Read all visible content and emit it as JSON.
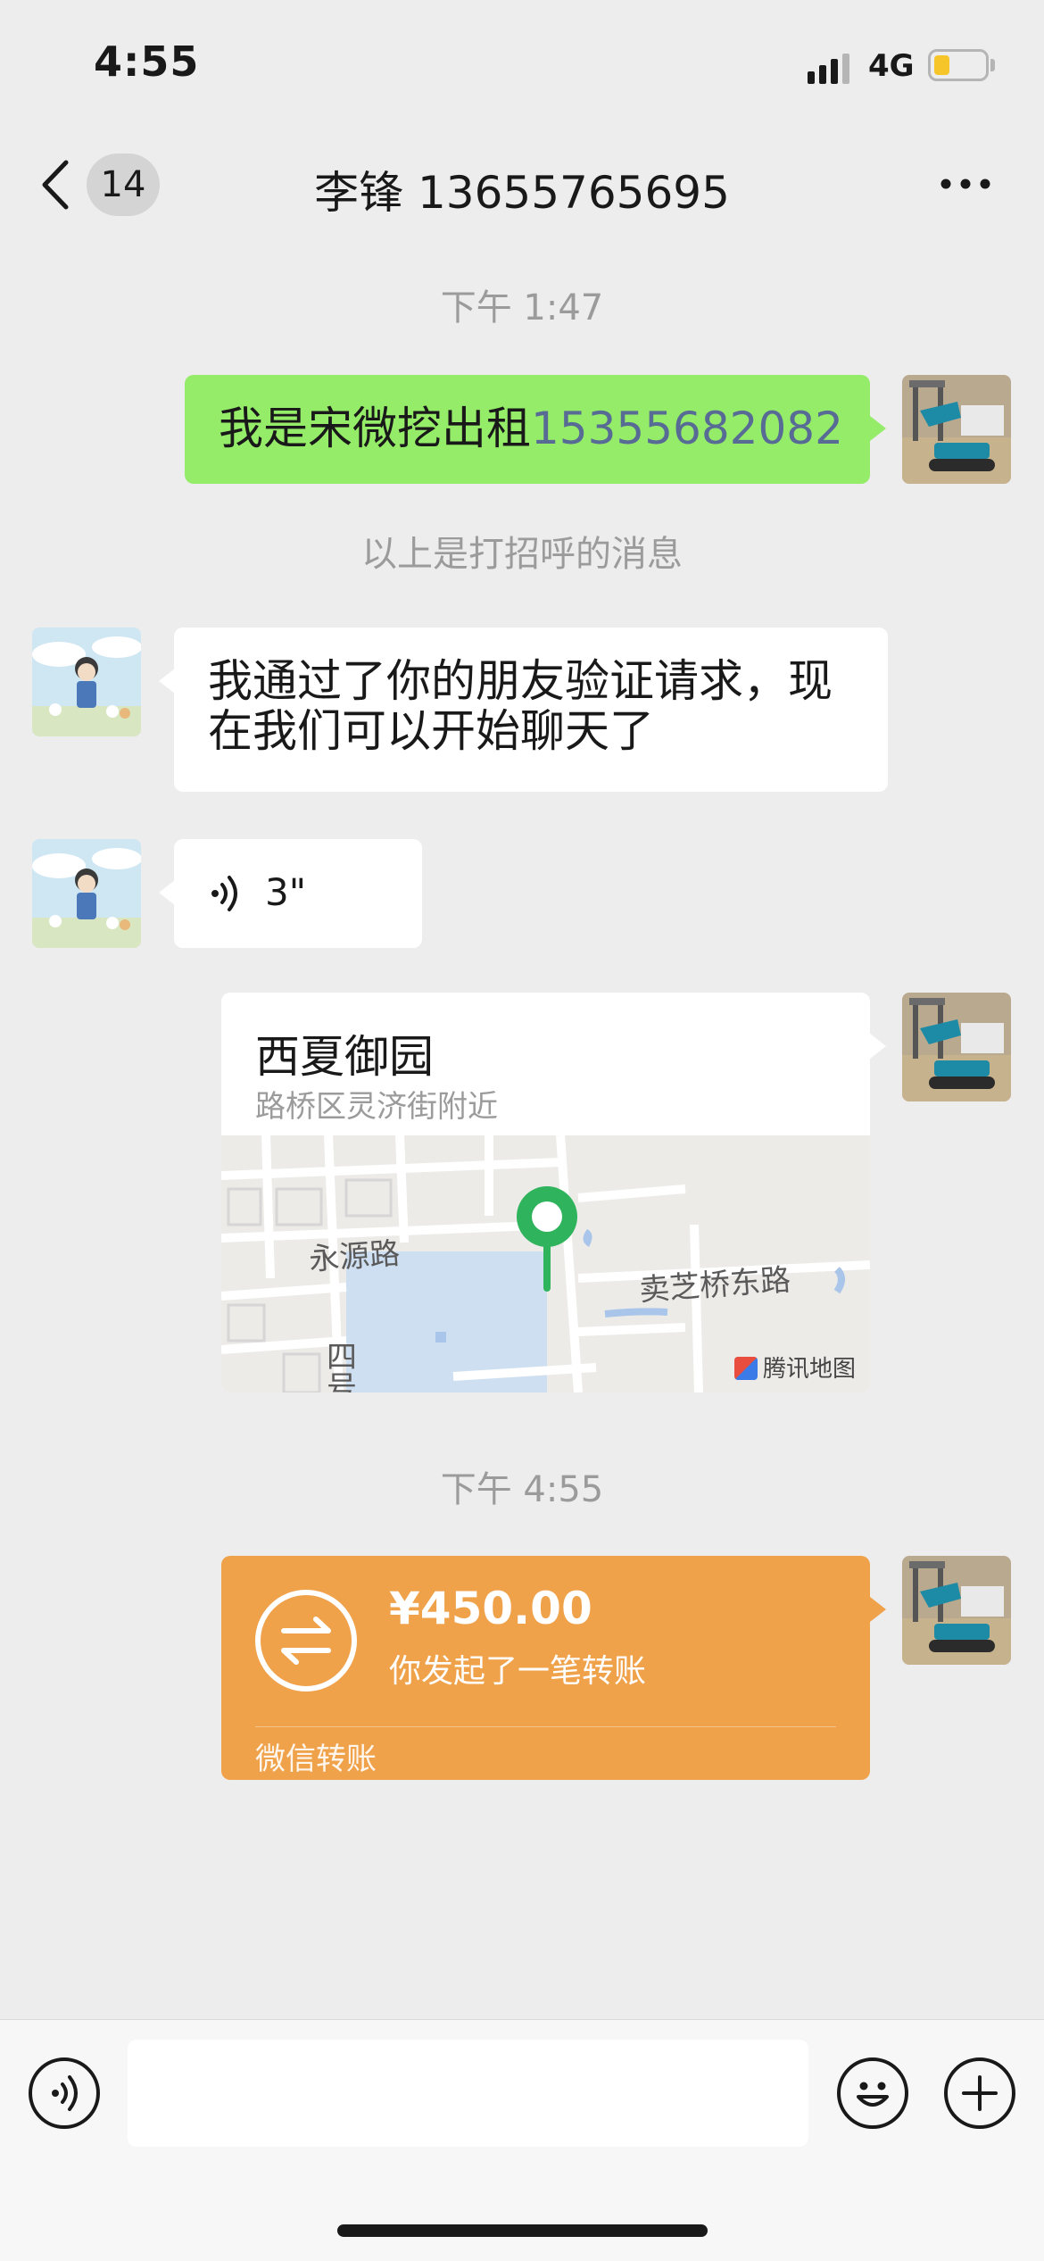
{
  "status_bar": {
    "time": "4:55",
    "network": "4G",
    "battery_level": 0.3
  },
  "header": {
    "unread_count": "14",
    "title": "李锋 13655765695"
  },
  "messages": {
    "timestamp_1": "下午 1:47",
    "greeting_text": "我是宋微挖出租",
    "greeting_phone": "15355682082",
    "system_note": "以上是打招呼的消息",
    "friend_accept": "我通过了你的朋友验证请求，现在我们可以开始聊天了",
    "voice_duration": "3\"",
    "location": {
      "name": "西夏御园",
      "address": "路桥区灵济街附近",
      "map_labels": {
        "road_1": "永源路",
        "road_2": "卖芝桥东路",
        "road_3": "四号"
      },
      "map_brand": "腾讯地图"
    },
    "timestamp_2": "下午 4:55",
    "transfer": {
      "amount": "¥450.00",
      "description": "你发起了一笔转账",
      "footer": "微信转账"
    }
  },
  "colors": {
    "sent_bubble": "#95ec69",
    "transfer_card": "#f0a24b",
    "background": "#ededed",
    "link": "#576b95"
  },
  "input": {
    "placeholder": ""
  }
}
